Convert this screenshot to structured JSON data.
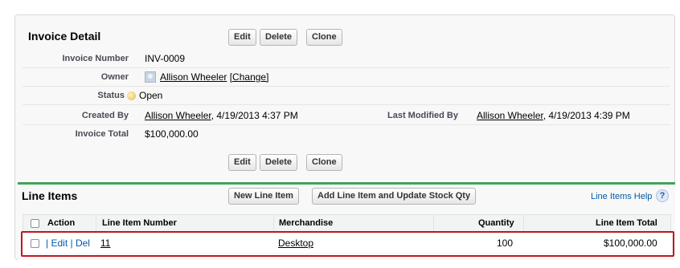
{
  "detail": {
    "title": "Invoice Detail",
    "buttons": [
      "Edit",
      "Delete",
      "Clone"
    ],
    "fields": {
      "invoice_number_label": "Invoice Number",
      "invoice_number": "INV-0009",
      "owner_label": "Owner",
      "owner": "Allison Wheeler",
      "owner_change": "[Change]",
      "status_label": "Status",
      "status": "Open",
      "created_by_label": "Created By",
      "created_by_name": "Allison Wheeler",
      "created_by_date": ", 4/19/2013 4:37 PM",
      "last_modified_label": "Last Modified By",
      "last_modified_name": "Allison Wheeler",
      "last_modified_date": ", 4/19/2013 4:39 PM",
      "invoice_total_label": "Invoice Total",
      "invoice_total": "$100,000.00"
    }
  },
  "line_items": {
    "title": "Line Items",
    "new_button": "New Line Item",
    "add_button": "Add Line Item and Update Stock Qty",
    "help": "Line Items Help",
    "help_icon": "?",
    "columns": [
      "Action",
      "Line Item Number",
      "Merchandise",
      "Quantity",
      "Line Item Total"
    ],
    "rows": [
      {
        "edit": "Edit",
        "del": "Del",
        "sep1": "|",
        "sep2": "|",
        "number": "11",
        "merchandise": "Desktop",
        "quantity": "100",
        "total": "$100,000.00"
      }
    ]
  },
  "colors": {
    "accent_green": "#3fa35a",
    "highlight_red": "#c0171f",
    "link_blue": "#015ba7"
  }
}
